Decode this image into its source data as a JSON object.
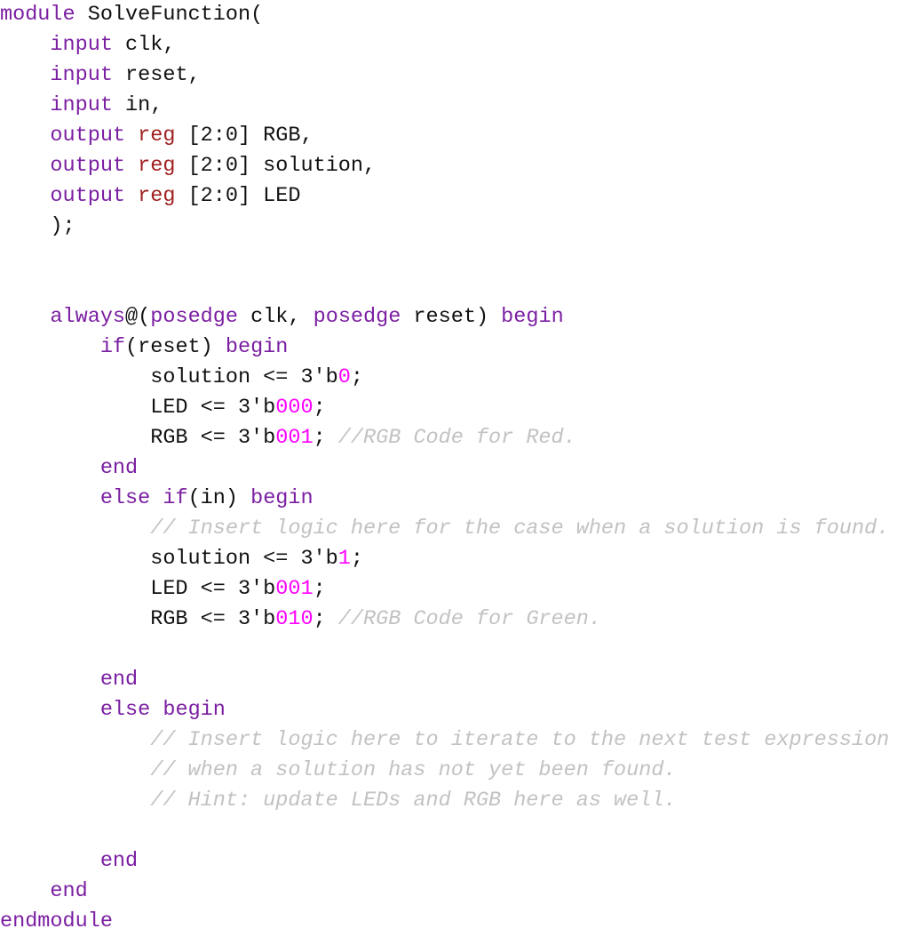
{
  "editor": {
    "language": "Verilog",
    "module_name": "SolveFunction",
    "background_color": "#ffffff",
    "colors": {
      "keyword": "#7b1fa2",
      "type": "#a02020",
      "number": "#ff00ff",
      "comment": "#c2c2c2",
      "plain": "#111111"
    }
  },
  "code": {
    "lines": [
      {
        "n": 1,
        "tokens": [
          {
            "t": "keyword",
            "s": "module"
          },
          {
            "t": "plain",
            "s": " SolveFunction("
          }
        ]
      },
      {
        "n": 2,
        "tokens": [
          {
            "t": "plain",
            "s": "    "
          },
          {
            "t": "keyword",
            "s": "input"
          },
          {
            "t": "plain",
            "s": " clk,"
          }
        ]
      },
      {
        "n": 3,
        "tokens": [
          {
            "t": "plain",
            "s": "    "
          },
          {
            "t": "keyword",
            "s": "input"
          },
          {
            "t": "plain",
            "s": " reset,"
          }
        ]
      },
      {
        "n": 4,
        "tokens": [
          {
            "t": "plain",
            "s": "    "
          },
          {
            "t": "keyword",
            "s": "input"
          },
          {
            "t": "plain",
            "s": " in,"
          }
        ]
      },
      {
        "n": 5,
        "tokens": [
          {
            "t": "plain",
            "s": "    "
          },
          {
            "t": "keyword",
            "s": "output"
          },
          {
            "t": "plain",
            "s": " "
          },
          {
            "t": "type",
            "s": "reg"
          },
          {
            "t": "plain",
            "s": " [2:0] RGB,"
          }
        ]
      },
      {
        "n": 6,
        "tokens": [
          {
            "t": "plain",
            "s": "    "
          },
          {
            "t": "keyword",
            "s": "output"
          },
          {
            "t": "plain",
            "s": " "
          },
          {
            "t": "type",
            "s": "reg"
          },
          {
            "t": "plain",
            "s": " [2:0] solution,"
          }
        ]
      },
      {
        "n": 7,
        "tokens": [
          {
            "t": "plain",
            "s": "    "
          },
          {
            "t": "keyword",
            "s": "output"
          },
          {
            "t": "plain",
            "s": " "
          },
          {
            "t": "type",
            "s": "reg"
          },
          {
            "t": "plain",
            "s": " [2:0] LED"
          }
        ]
      },
      {
        "n": 8,
        "tokens": [
          {
            "t": "plain",
            "s": "    );"
          }
        ]
      },
      {
        "n": 9,
        "tokens": [
          {
            "t": "blank",
            "s": " "
          }
        ]
      },
      {
        "n": 10,
        "tokens": [
          {
            "t": "blank",
            "s": " "
          }
        ]
      },
      {
        "n": 11,
        "tokens": [
          {
            "t": "plain",
            "s": "    "
          },
          {
            "t": "keyword",
            "s": "always"
          },
          {
            "t": "plain",
            "s": "@("
          },
          {
            "t": "keyword",
            "s": "posedge"
          },
          {
            "t": "plain",
            "s": " clk, "
          },
          {
            "t": "keyword",
            "s": "posedge"
          },
          {
            "t": "plain",
            "s": " reset) "
          },
          {
            "t": "keyword",
            "s": "begin"
          }
        ]
      },
      {
        "n": 12,
        "tokens": [
          {
            "t": "plain",
            "s": "        "
          },
          {
            "t": "keyword",
            "s": "if"
          },
          {
            "t": "plain",
            "s": "(reset) "
          },
          {
            "t": "keyword",
            "s": "begin"
          }
        ]
      },
      {
        "n": 13,
        "tokens": [
          {
            "t": "plain",
            "s": "            solution <= 3'b"
          },
          {
            "t": "number",
            "s": "0"
          },
          {
            "t": "plain",
            "s": ";"
          }
        ]
      },
      {
        "n": 14,
        "tokens": [
          {
            "t": "plain",
            "s": "            LED <= 3'b"
          },
          {
            "t": "number",
            "s": "000"
          },
          {
            "t": "plain",
            "s": ";"
          }
        ]
      },
      {
        "n": 15,
        "tokens": [
          {
            "t": "plain",
            "s": "            RGB <= 3'b"
          },
          {
            "t": "number",
            "s": "001"
          },
          {
            "t": "plain",
            "s": "; "
          },
          {
            "t": "comment",
            "s": "//RGB Code for Red."
          }
        ]
      },
      {
        "n": 16,
        "tokens": [
          {
            "t": "plain",
            "s": "        "
          },
          {
            "t": "keyword",
            "s": "end"
          }
        ]
      },
      {
        "n": 17,
        "tokens": [
          {
            "t": "plain",
            "s": "        "
          },
          {
            "t": "keyword",
            "s": "else"
          },
          {
            "t": "plain",
            "s": " "
          },
          {
            "t": "keyword",
            "s": "if"
          },
          {
            "t": "plain",
            "s": "(in) "
          },
          {
            "t": "keyword",
            "s": "begin"
          }
        ]
      },
      {
        "n": 18,
        "tokens": [
          {
            "t": "plain",
            "s": "            "
          },
          {
            "t": "comment",
            "s": "// Insert logic here for the case when a solution is found."
          }
        ]
      },
      {
        "n": 19,
        "tokens": [
          {
            "t": "plain",
            "s": "            solution <= 3'b"
          },
          {
            "t": "number",
            "s": "1"
          },
          {
            "t": "plain",
            "s": ";"
          }
        ]
      },
      {
        "n": 20,
        "tokens": [
          {
            "t": "plain",
            "s": "            LED <= 3'b"
          },
          {
            "t": "number",
            "s": "001"
          },
          {
            "t": "plain",
            "s": ";"
          }
        ]
      },
      {
        "n": 21,
        "tokens": [
          {
            "t": "plain",
            "s": "            RGB <= 3'b"
          },
          {
            "t": "number",
            "s": "010"
          },
          {
            "t": "plain",
            "s": "; "
          },
          {
            "t": "comment",
            "s": "//RGB Code for Green."
          }
        ]
      },
      {
        "n": 22,
        "tokens": [
          {
            "t": "blank",
            "s": " "
          }
        ]
      },
      {
        "n": 23,
        "tokens": [
          {
            "t": "plain",
            "s": "        "
          },
          {
            "t": "keyword",
            "s": "end"
          }
        ]
      },
      {
        "n": 24,
        "tokens": [
          {
            "t": "plain",
            "s": "        "
          },
          {
            "t": "keyword",
            "s": "else"
          },
          {
            "t": "plain",
            "s": " "
          },
          {
            "t": "keyword",
            "s": "begin"
          }
        ]
      },
      {
        "n": 25,
        "tokens": [
          {
            "t": "plain",
            "s": "            "
          },
          {
            "t": "comment",
            "s": "// Insert logic here to iterate to the next test expression"
          }
        ]
      },
      {
        "n": 26,
        "tokens": [
          {
            "t": "plain",
            "s": "            "
          },
          {
            "t": "comment",
            "s": "// when a solution has not yet been found."
          }
        ]
      },
      {
        "n": 27,
        "tokens": [
          {
            "t": "plain",
            "s": "            "
          },
          {
            "t": "comment",
            "s": "// Hint: update LEDs and RGB here as well."
          }
        ]
      },
      {
        "n": 28,
        "tokens": [
          {
            "t": "blank",
            "s": " "
          }
        ]
      },
      {
        "n": 29,
        "tokens": [
          {
            "t": "plain",
            "s": "        "
          },
          {
            "t": "keyword",
            "s": "end"
          }
        ]
      },
      {
        "n": 30,
        "tokens": [
          {
            "t": "plain",
            "s": "    "
          },
          {
            "t": "keyword",
            "s": "end"
          }
        ]
      },
      {
        "n": 31,
        "tokens": [
          {
            "t": "keyword",
            "s": "endmodule"
          }
        ]
      }
    ]
  }
}
